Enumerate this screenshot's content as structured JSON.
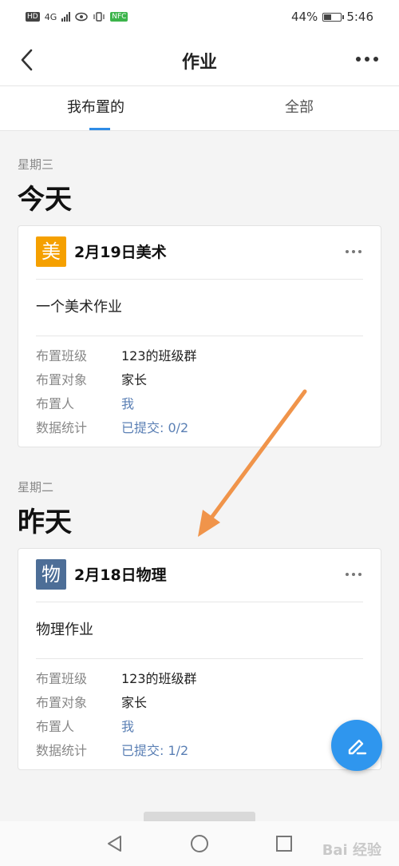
{
  "status_bar": {
    "hd": "HD",
    "network": "4G",
    "nfc": "NFC",
    "battery_text": "44%",
    "battery_level": 0.44,
    "time": "5:46"
  },
  "header": {
    "title": "作业",
    "back_icon": "chevron-left-icon",
    "more_icon": "more-horizontal-icon"
  },
  "tabs": [
    {
      "label": "我布置的",
      "active": true
    },
    {
      "label": "全部",
      "active": false
    }
  ],
  "groups": [
    {
      "weekday": "星期三",
      "day": "今天",
      "cards": [
        {
          "icon_char": "美",
          "icon_color": "#f5a000",
          "title": "2月19日美术",
          "description": "一个美术作业",
          "rows": [
            {
              "label": "布置班级",
              "value": "123的班级群"
            },
            {
              "label": "布置对象",
              "value": "家长"
            },
            {
              "label": "布置人",
              "value": "我"
            },
            {
              "label": "数据统计",
              "value": "已提交: 0/2"
            }
          ]
        }
      ]
    },
    {
      "weekday": "星期二",
      "day": "昨天",
      "cards": [
        {
          "icon_char": "物",
          "icon_color": "#4d6e97",
          "title": "2月18日物理",
          "description": "物理作业",
          "rows": [
            {
              "label": "布置班级",
              "value": "123的班级群"
            },
            {
              "label": "布置对象",
              "value": "家长"
            },
            {
              "label": "布置人",
              "value": "我"
            },
            {
              "label": "数据统计",
              "value": "已提交: 1/2"
            }
          ]
        }
      ]
    }
  ],
  "fab": {
    "icon": "edit-pencil-icon",
    "color": "#2f96ee"
  },
  "annotation": {
    "arrow_color": "#f0944a"
  },
  "watermark": "Bai 经验",
  "nav_bar": {
    "back_icon": "triangle-back-icon",
    "home_icon": "circle-home-icon",
    "recent_icon": "square-recent-icon"
  }
}
